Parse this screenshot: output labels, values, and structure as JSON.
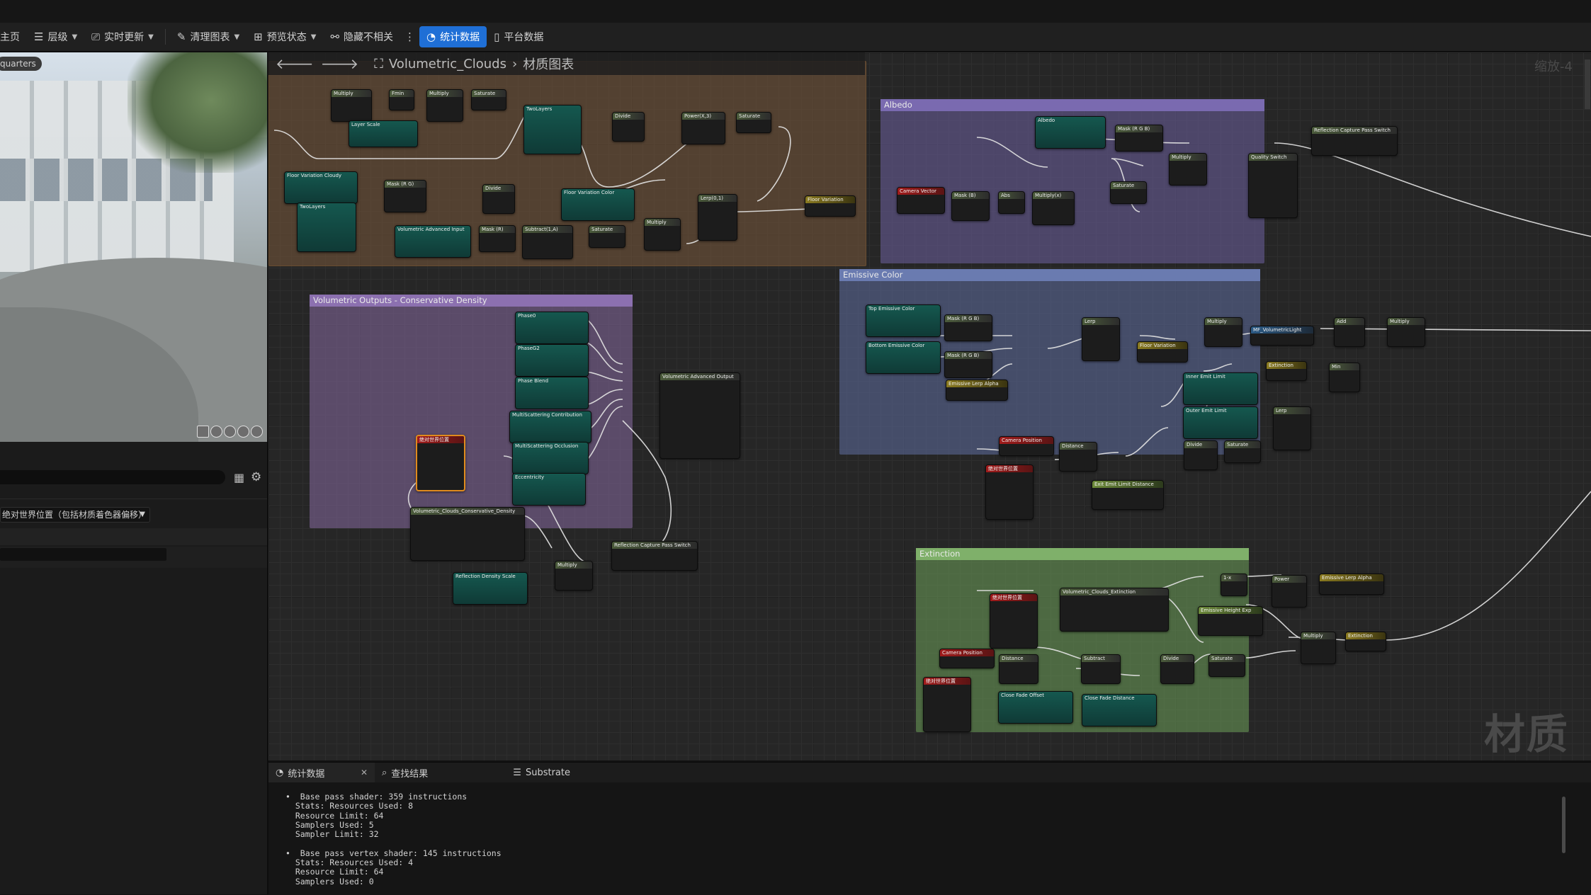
{
  "toolbar": {
    "items": [
      {
        "label": "主页"
      },
      {
        "label": "层级"
      },
      {
        "label": "实时更新"
      },
      {
        "label": "清理图表"
      },
      {
        "label": "预览状态"
      },
      {
        "label": "隐藏不相关"
      },
      {
        "label": "统计数据"
      },
      {
        "label": "平台数据"
      }
    ]
  },
  "viewport": {
    "label": "quarters"
  },
  "details": {
    "dropdown": "绝对世界位置（包括材质着色器偏移）"
  },
  "graph": {
    "breadcrumb": {
      "asset": "Volumetric_Clouds",
      "graph": "材质图表"
    },
    "zoom": "缩放-4",
    "watermark": "材质",
    "comments": {
      "albedo": "Albedo",
      "emissive": "Emissive Color",
      "volumetric": "Volumetric Outputs - Conservative Density",
      "extinction": "Extinction"
    },
    "nodes": {
      "n01": "Multiply",
      "n02": "Fmin",
      "n03": "Multiply",
      "n04": "Saturate",
      "n05": "Layer Scale",
      "n06": "TwoLayers",
      "n07": "Divide",
      "n08": "Power(X,3)",
      "n09": "Saturate",
      "n10": "Floor Variation Cloudy",
      "n11": "Mask (R G)",
      "n12": "Divide",
      "n13": "Floor Variation Color",
      "n14": "TwoLayers",
      "n15": "Volumetric Advanced Input",
      "n16": "Mask (R)",
      "n17": "Subtract(1,A)",
      "n18": "Saturate",
      "n19": "Multiply",
      "n20": "Lerp(0,1)",
      "n21": "Floor Variation",
      "a1": "Albedo",
      "a2": "Mask (R G B)",
      "a3": "Multiply",
      "a4": "Quality Switch",
      "a5": "Reflection Capture Pass Switch",
      "a6": "Camera Vector",
      "a7": "Mask (B)",
      "a8": "Abs",
      "a9": "Multiply(x)",
      "a10": "Saturate",
      "e1": "Top Emissive Color",
      "e2": "Mask (R G B)",
      "e3": "Lerp",
      "e4": "Multiply",
      "e5": "MF_VolumetricLight",
      "e6": "Add",
      "e7": "Multiply",
      "e8": "Bottom Emissive Color",
      "e9": "Mask (R G B)",
      "e10": "Floor Variation",
      "e11": "Emissive Lerp Alpha",
      "e12": "Extinction",
      "e13": "Min",
      "e14": "Inner Emit Limit",
      "e15": "Outer Emit Limit",
      "e16": "Lerp",
      "e17": "Camera Position",
      "e18": "Distance",
      "e19": "Divide",
      "e20": "Saturate",
      "e21": "绝对世界位置",
      "e22": "Exit Emit Limit Distance",
      "v1": "Phase0",
      "v2": "PhaseG2",
      "v3": "Phase Blend",
      "v4": "MultiScattering Contribution",
      "v5": "MultiScattering Occlusion",
      "v6": "Eccentricity",
      "v7": "Volumetric Advanced Output",
      "v8": "绝对世界位置",
      "v9": "Volumetric_Clouds_Conservative_Density",
      "v10": "Reflection Capture Pass Switch",
      "v11": "Multiply",
      "v12": "Reflection Density Scale",
      "x1": "绝对世界位置",
      "x2": "Volumetric_Clouds_Extinction",
      "x3": "1-x",
      "x4": "Power",
      "x5": "Emissive Lerp Alpha",
      "x6": "Emissive Height Exp",
      "x7": "Multiply",
      "x8": "Extinction",
      "x9": "Camera Position",
      "x10": "Distance",
      "x11": "Subtract",
      "x12": "Divide",
      "x13": "Saturate",
      "x14": "绝对世界位置",
      "x15": "Close Fade Offset",
      "x16": "Close Fade Distance"
    }
  },
  "bottom": {
    "tabs": [
      {
        "label": "统计数据"
      },
      {
        "label": "查找结果"
      },
      {
        "label": "Substrate"
      }
    ],
    "stats": [
      "Base pass shader: 359 instructions",
      "  Stats: Resources Used: 8",
      "  Resource Limit: 64",
      "  Samplers Used: 5",
      "  Sampler Limit: 32",
      "",
      "Base pass vertex shader: 145 instructions",
      "  Stats: Resources Used: 4",
      "  Resource Limit: 64",
      "  Samplers Used: 0"
    ]
  }
}
